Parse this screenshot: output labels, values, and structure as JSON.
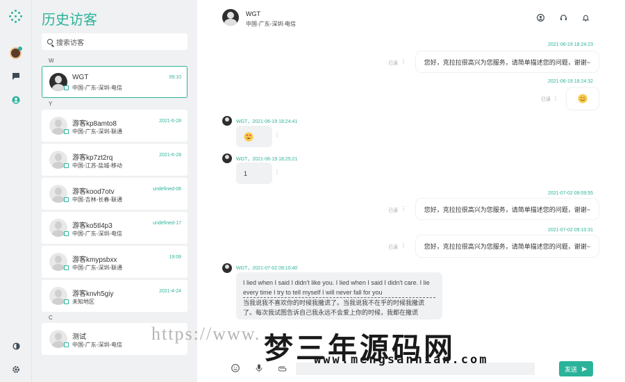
{
  "app": {
    "title": "历史访客",
    "search_placeholder": "搜索访客"
  },
  "groups": [
    "W",
    "Y",
    "C"
  ],
  "visitors": [
    {
      "name": "WGT",
      "location": "中国-广东-深圳-电信",
      "time": "09:10",
      "device": "mobile",
      "active": true
    },
    {
      "name": "游客kp8amto8",
      "location": "中国-广东-深圳-联通",
      "time": "2021-6-28",
      "device": "mobile"
    },
    {
      "name": "游客kp7zt2rq",
      "location": "中国-江苏-盐城-移动",
      "time": "2021-6-28",
      "device": "desktop"
    },
    {
      "name": "游客kood7otv",
      "location": "中国-吉林-长春-联通",
      "time": "undefined-06",
      "device": "desktop"
    },
    {
      "name": "游客ko5tl4p3",
      "location": "中国-广东-深圳-电信",
      "time": "undefined-17",
      "device": "desktop"
    },
    {
      "name": "游客kmypsbxx",
      "location": "中国-广东-深圳-联通",
      "time": "19:09",
      "device": "desktop"
    },
    {
      "name": "游客knvh5giy",
      "location": "未知地区",
      "time": "2021-4-24",
      "device": "desktop"
    },
    {
      "name": "测试",
      "location": "中国-广东-深圳-电信",
      "time": "",
      "device": "desktop"
    }
  ],
  "chat": {
    "name": "WGT",
    "location": "中国-广东-深圳-电信",
    "read_label": "已读",
    "messages": [
      {
        "side": "right",
        "timestamp": "2021-06-19 18:24:23",
        "text": "您好，克拉拉很高兴为您服务，请简单描述您的问题，谢谢~"
      },
      {
        "side": "right",
        "timestamp": "2021-06-19 18:24:32",
        "emoji": "smile"
      },
      {
        "side": "left",
        "meta": "WGT，2021-06-19 18:24:41",
        "emoji": "heart-eyes"
      },
      {
        "side": "left",
        "meta": "WGT，2021-06-19 18:25:21",
        "text": "1"
      },
      {
        "side": "right",
        "timestamp": "2021-07-02 09:09:55",
        "text": "您好，克拉拉很高兴为您服务，请简单描述您的问题，谢谢~"
      },
      {
        "side": "right",
        "timestamp": "2021-07-02 09:10:31",
        "text": "您好，克拉拉很高兴为您服务，请简单描述您的问题，谢谢~"
      },
      {
        "side": "left",
        "meta": "WGT，2021-07-02 09:10:40",
        "text_en": "I lied when I said I didn't like you. I lied when I said I didn't care. I lie every time I try to tell myself I will never fall for you",
        "text_zh": "当我说我不喜欢你的时候我撒谎了。当我说我不在乎的时候我撒谎了。每次我试图告诉自己我永远不会爱上你的时候，我都在撒谎"
      }
    ]
  },
  "input": {
    "send_label": "发送"
  },
  "watermark": {
    "url": "https://www.",
    "brand": "梦三年源码网",
    "domain": "www.mengsannian.com"
  },
  "colors": {
    "accent": "#2bb39a",
    "bubble_left": "#f0f1f3"
  }
}
